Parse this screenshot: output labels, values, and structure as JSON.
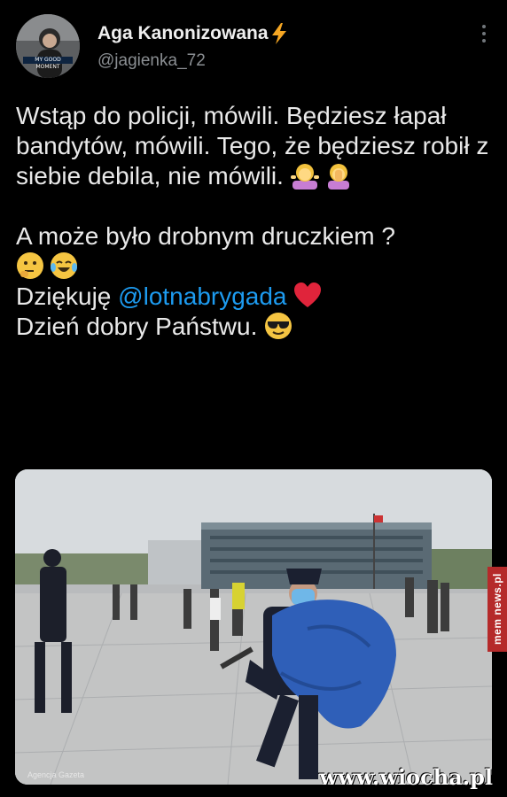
{
  "user": {
    "display_name": "Aga Kanonizowana",
    "handle": "@jagienka_72",
    "avatar_label": "MY GOOD MOMENT",
    "verified_icon": "lightning-bolt-icon"
  },
  "tweet": {
    "para1": "Wstąp do policji, mówili. Będziesz łapał bandytów, mówili. Tego, że będziesz robił z siebie debila, nie mówili.",
    "line_question": "A może było drobnym druczkiem ?",
    "thanks_prefix": "Dziękuję",
    "mention": "@lotnabrygada",
    "closing": "Dzień dobry Państwu.",
    "emojis": [
      "woman-shrugging-emoji",
      "woman-facepalming-emoji",
      "thinking-face-emoji",
      "tears-of-joy-emoji",
      "red-heart-emoji",
      "sunglasses-face-emoji"
    ]
  },
  "media": {
    "credit": "Agencja Gazeta"
  },
  "watermarks": {
    "side": "mem news.pl",
    "bottom": "www.wiocha.pl"
  },
  "colors": {
    "background": "#000000",
    "mention": "#1d9bf0",
    "bolt": "#f5a623"
  }
}
